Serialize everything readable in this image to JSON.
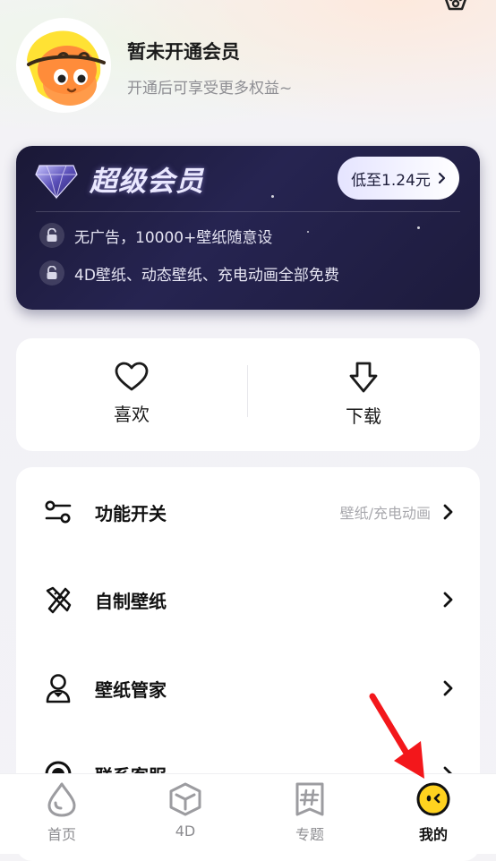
{
  "profile": {
    "name": "暂未开通会员",
    "subtitle": "开通后可享受更多权益~"
  },
  "vip": {
    "title": "超级会员",
    "price_button": "低至1.24元",
    "benefits": [
      "无广告，10000+壁纸随意设",
      "4D壁纸、动态壁纸、充电动画全部免费"
    ]
  },
  "quick": {
    "like_label": "喜欢",
    "download_label": "下载"
  },
  "menu": {
    "items": [
      {
        "label": "功能开关",
        "value": "壁纸/充电动画",
        "icon": "toggle-switches-icon"
      },
      {
        "label": "自制壁纸",
        "value": "",
        "icon": "brush-ruler-icon"
      },
      {
        "label": "壁纸管家",
        "value": "",
        "icon": "butler-icon"
      },
      {
        "label": "联系客服",
        "value": "",
        "icon": "headset-icon"
      }
    ]
  },
  "tabbar": {
    "tabs": [
      {
        "label": "首页",
        "icon": "drop-icon"
      },
      {
        "label": "4D",
        "icon": "cube-icon"
      },
      {
        "label": "专题",
        "icon": "hashtag-icon"
      },
      {
        "label": "我的",
        "icon": "smiley-icon",
        "active": true
      }
    ]
  },
  "colors": {
    "vip_bg": "#221f46",
    "accent_yellow": "#ffd21f",
    "annotation_red": "#f3171b"
  }
}
